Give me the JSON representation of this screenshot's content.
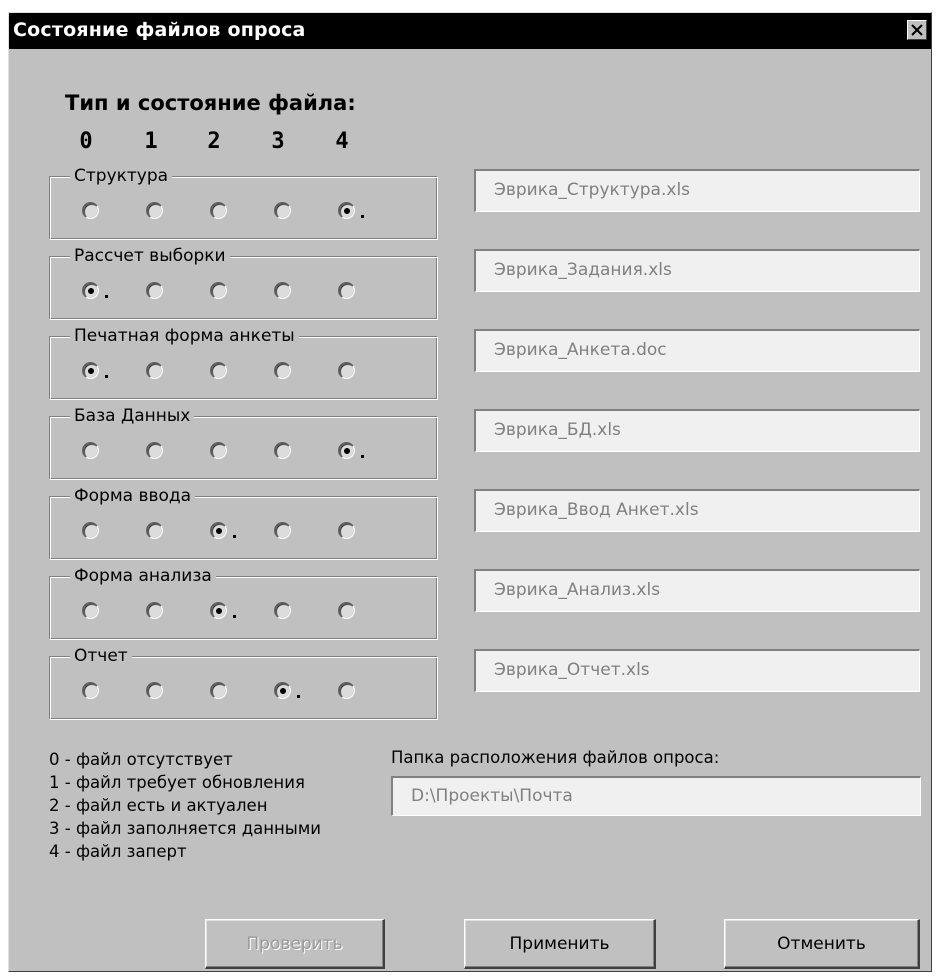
{
  "window": {
    "title": "Состояние файлов опроса"
  },
  "header": {
    "label": "Тип и состояние файла:",
    "columns": [
      "0",
      "1",
      "2",
      "3",
      "4"
    ]
  },
  "groups": [
    {
      "label": "Структура",
      "selected": 4,
      "file": "Эврика_Структура.xls"
    },
    {
      "label": "Рассчет выборки",
      "selected": 0,
      "file": "Эврика_Задания.xls"
    },
    {
      "label": "Печатная форма анкеты",
      "selected": 0,
      "file": "Эврика_Анкета.doc"
    },
    {
      "label": "База Данных",
      "selected": 4,
      "file": "Эврика_БД.xls"
    },
    {
      "label": "Форма ввода",
      "selected": 2,
      "file": "Эврика_Ввод Анкет.xls"
    },
    {
      "label": "Форма анализа",
      "selected": 2,
      "file": "Эврика_Анализ.xls"
    },
    {
      "label": "Отчет",
      "selected": 3,
      "file": "Эврика_Отчет.xls"
    }
  ],
  "legend": [
    "0 - файл отсутствует",
    "1 - файл требует обновления",
    "2 - файл есть и актуален",
    "3 - файл заполняется данными",
    "4 - файл заперт"
  ],
  "folder": {
    "label": "Папка расположения файлов опроса:",
    "value": "D:\\Проекты\\Почта"
  },
  "buttons": {
    "check": "Проверить",
    "apply": "Применить",
    "cancel": "Отменить"
  }
}
